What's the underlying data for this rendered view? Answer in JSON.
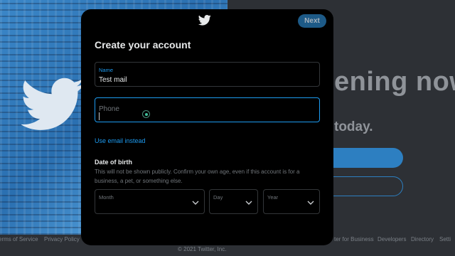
{
  "background": {
    "headline": "ening now",
    "subtext": "today.",
    "footer_links": [
      "erms of Service",
      "Privacy Policy",
      "ter for Business",
      "Developers",
      "Directory",
      "Setti"
    ],
    "copyright": "© 2021 Twitter, Inc."
  },
  "modal": {
    "logo_icon": "twitter-bird-icon",
    "next_label": "Next",
    "title": "Create your account",
    "name_field": {
      "label": "Name",
      "value": "Test mail"
    },
    "phone_field": {
      "placeholder": "Phone"
    },
    "email_link": "Use email instead",
    "dob": {
      "title": "Date of birth",
      "description": "This will not be shown publicly. Confirm your own age, even if this account is for a business, a pet, or something else.",
      "month_label": "Month",
      "day_label": "Day",
      "year_label": "Year"
    }
  },
  "colors": {
    "accent": "#1d9bf0",
    "modal_bg": "#000000",
    "overlay_bg": "#2d3035"
  }
}
